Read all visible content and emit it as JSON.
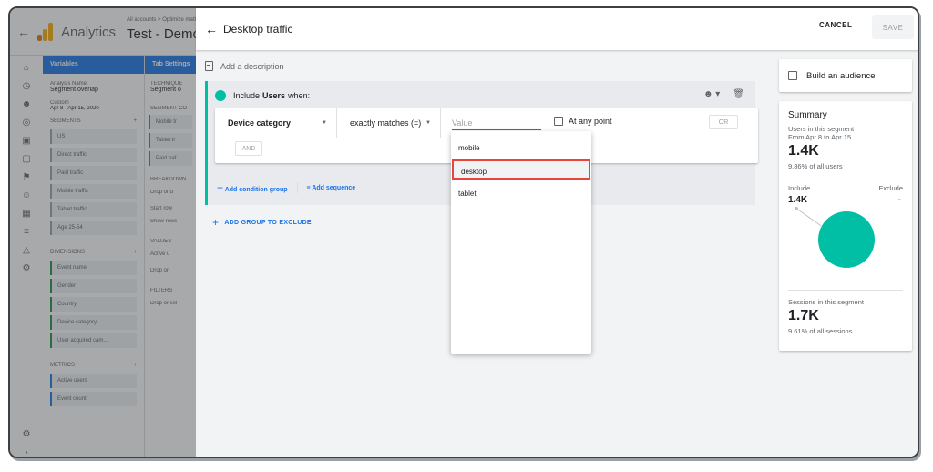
{
  "app": {
    "name": "Analytics",
    "breadcrumb": "All accounts > Optimize matte",
    "property": "Test - Demo - Ec"
  },
  "variables": {
    "header": "Variables",
    "analysis_name_label": "Analysis Name:",
    "analysis_name": "Segment overlap",
    "date_label": "Custom",
    "date_range": "Apr 8 - Apr 15, 2020",
    "segments_title": "SEGMENTS",
    "segments": [
      "US",
      "Direct traffic",
      "Paid traffic",
      "Mobile traffic",
      "Tablet traffic",
      "Age 25-54"
    ],
    "dimensions_title": "DIMENSIONS",
    "dimensions": [
      "Event name",
      "Gender",
      "Country",
      "Device category",
      "User acquired cam..."
    ],
    "metrics_title": "METRICS",
    "metrics": [
      "Active users",
      "Event count"
    ]
  },
  "tab_settings": {
    "header": "Tab Settings",
    "technique_label": "TECHNIQUE",
    "technique": "Segment o",
    "segment_comparisons": "SEGMENT CO",
    "chips": [
      "Mobile tr",
      "Tablet tr",
      "Paid traf"
    ],
    "breakdowns": "BREAKDOWN",
    "drop_or": "Drop or d",
    "start_row": "Start row",
    "show_rows": "Show rows",
    "values": "VALUES",
    "active": "Active u",
    "drop_or2": "Drop or",
    "filters": "FILTERS",
    "drop_sel": "Drop or sel"
  },
  "editor": {
    "title": "Desktop traffic",
    "cancel": "CANCEL",
    "save": "SAVE",
    "description_placeholder": "Add a description",
    "include_prefix": "Include",
    "include_scope": "Users",
    "include_suffix": "when:",
    "condition": {
      "field": "Device category",
      "operator": "exactly matches (=)",
      "value_placeholder": "Value",
      "at_any_point": "At any point",
      "or": "OR",
      "and": "AND"
    },
    "add_condition_group": "Add condition group",
    "add_sequence": "Add sequence",
    "add_group_to_exclude": "ADD GROUP TO EXCLUDE"
  },
  "dropdown": {
    "options": [
      "mobile",
      "desktop",
      "tablet"
    ],
    "highlighted": "desktop"
  },
  "right": {
    "build_audience": "Build an audience",
    "summary": {
      "title": "Summary",
      "users_label": "Users in this segment",
      "date_text": "From Apr 8 to Apr 15",
      "users_value": "1.4K",
      "users_pct": "9.86% of all users",
      "include_label": "Include",
      "exclude_label": "Exclude",
      "include_value": "1.4K",
      "exclude_value": "-",
      "sessions_label": "Sessions in this segment",
      "sessions_value": "1.7K",
      "sessions_pct": "9.61% of all sessions"
    }
  },
  "colors": {
    "accent": "#1a73e8",
    "segment": "#01bfa5",
    "highlight_border": "#e8453c"
  }
}
